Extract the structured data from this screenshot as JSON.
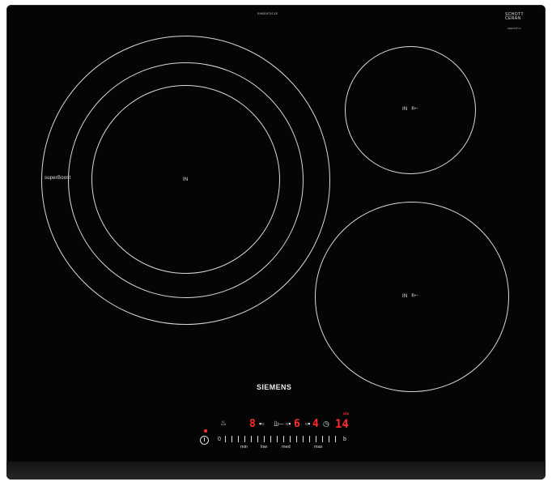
{
  "hob": {
    "model_number": "EH651FDC1E",
    "brand": "SIEMENS",
    "glass_brand": [
      "SCHOTT",
      "CERAN"
    ],
    "glass_small": "CERAN® Hi"
  },
  "zones": {
    "large_left": {
      "label": "IN",
      "boost_label": "superBoost"
    },
    "top_right": {
      "label": "IN",
      "symbol": "⫫⟝"
    },
    "bottom_right": {
      "label": "IN",
      "symbol": "⫫⟝"
    }
  },
  "control_panel": {
    "display_left": "8",
    "display_mid1": "6",
    "display_mid2": "4",
    "display_timer": "14",
    "timer_unit": "min",
    "slider_start": "0",
    "slider_end": "b",
    "slider_labels": [
      "min",
      "low",
      "med",
      "max"
    ]
  },
  "colors": {
    "glass": "#050505",
    "zone_outline": "#d9d9d9",
    "display_red": "#ff2a2a"
  }
}
